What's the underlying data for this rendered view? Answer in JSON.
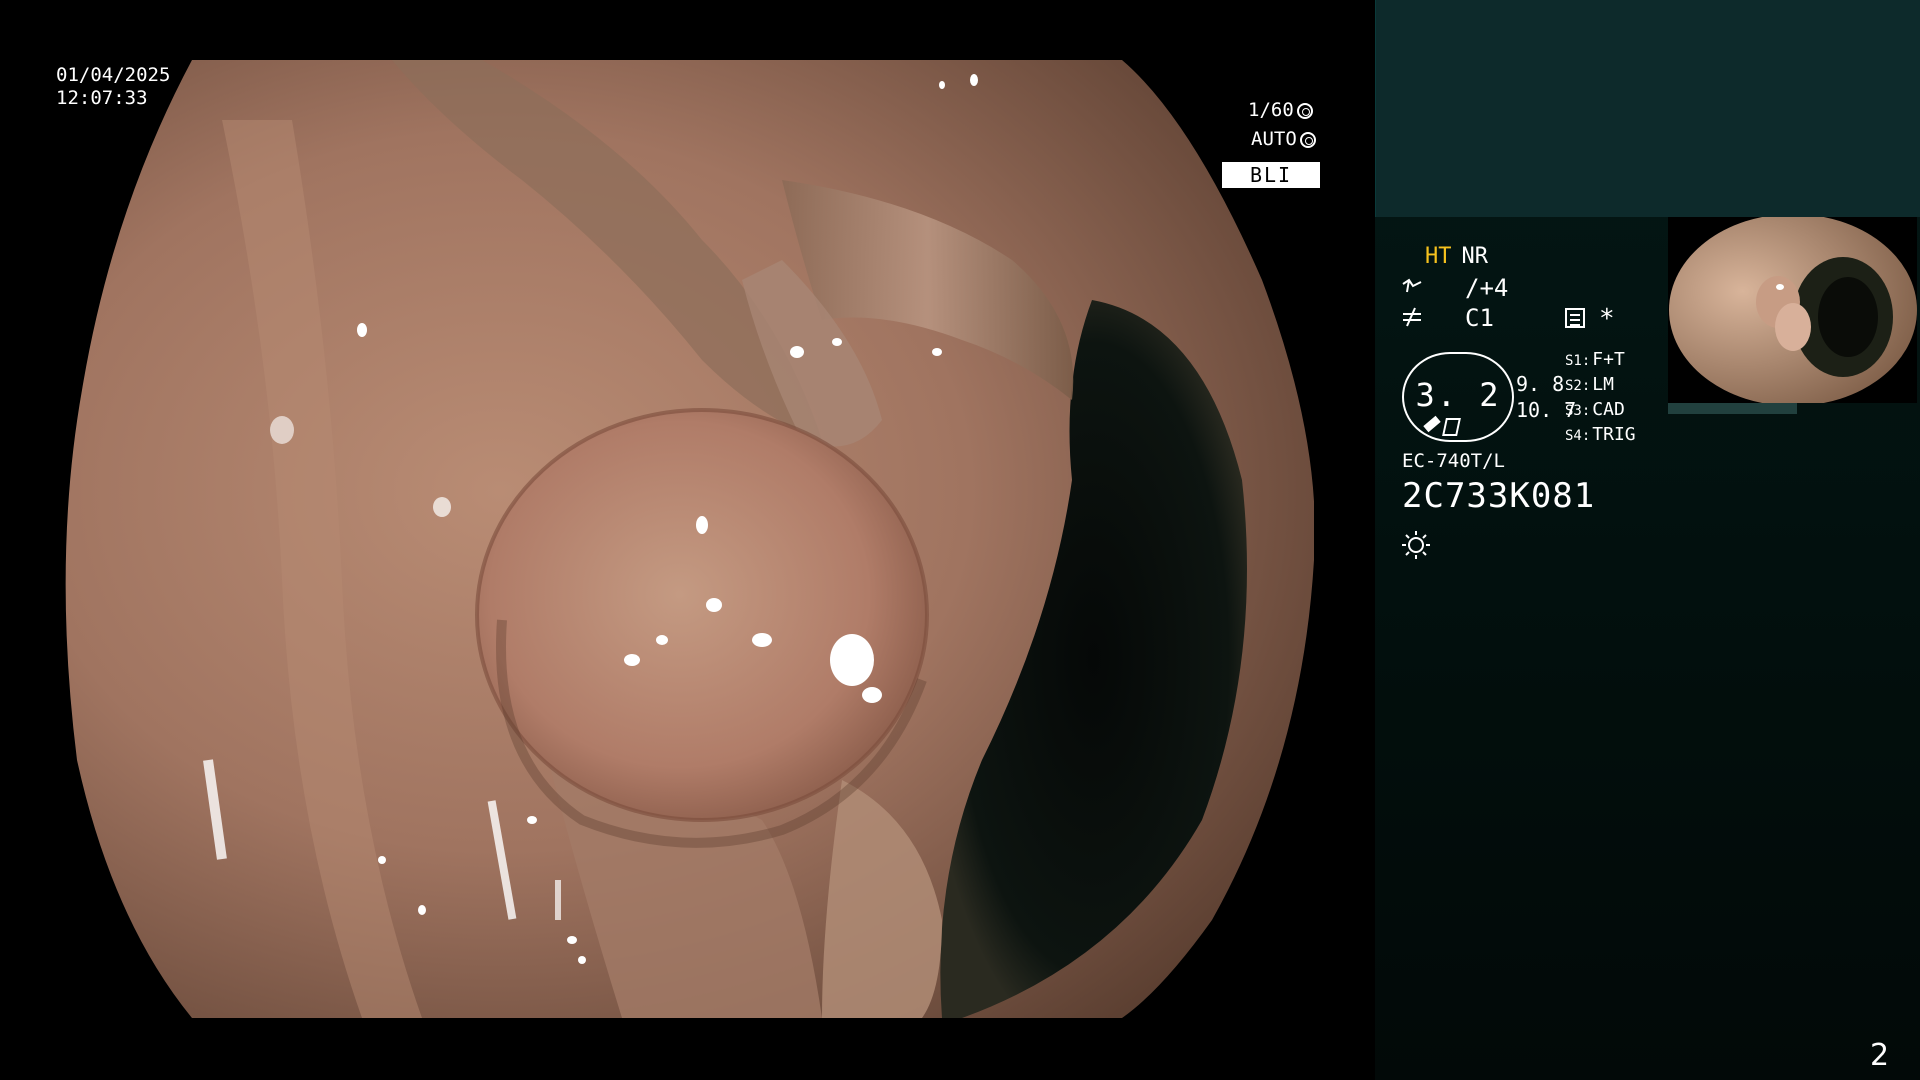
{
  "overlay": {
    "date": "01/04/2025",
    "time": "12:07:33",
    "shutter": "1/60",
    "shutter_icon": "aperture-icon",
    "auto_label": "AUTO",
    "auto_icon": "iris-icon",
    "mode_label": "BLI"
  },
  "side_panel": {
    "ht_label": "HT",
    "nr_label": "NR",
    "enhance_value": "/+4",
    "color_value": "C1",
    "zoom_value": "3. 2",
    "side_value_1": "9. 8",
    "side_value_2": "10. 7",
    "slots": [
      {
        "key": "S1:",
        "value": "F+T"
      },
      {
        "key": "S2:",
        "value": "LM"
      },
      {
        "key": "S3:",
        "value": "CAD"
      },
      {
        "key": "S4:",
        "value": "TRIG"
      }
    ],
    "star": "*",
    "model": "EC-740T/L",
    "serial": "2C733K081",
    "light_icon": "light-source-icon"
  },
  "page_number": "2",
  "colors": {
    "panel_top": "#0d2a2b",
    "panel_bg": "#031311",
    "accent": "#f6c21e",
    "bli_box": "#ffffff"
  }
}
